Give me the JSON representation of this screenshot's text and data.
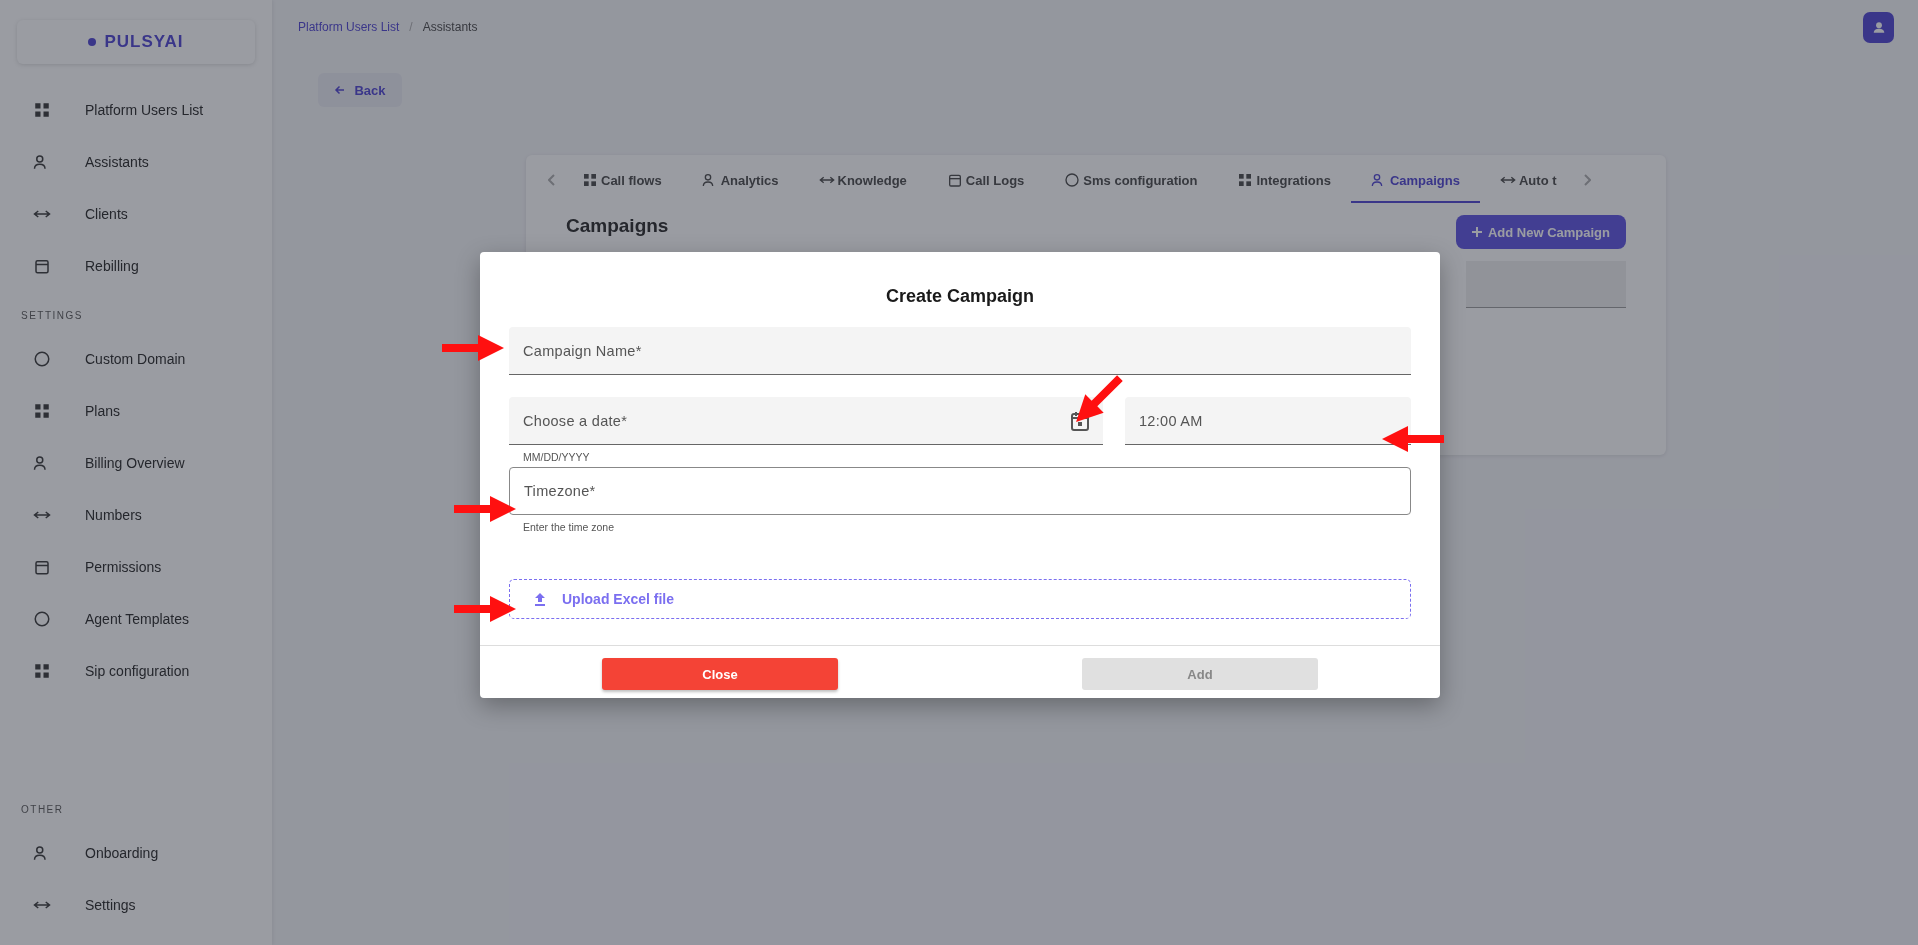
{
  "sidebar": {
    "logo": "PULSYAI",
    "sections": [
      {
        "items": [
          {
            "label": "Platform Users List"
          },
          {
            "label": "Assistants"
          },
          {
            "label": "Clients"
          },
          {
            "label": "Rebilling"
          }
        ]
      },
      {
        "heading": "SETTINGS",
        "items": [
          {
            "label": "Custom Domain"
          },
          {
            "label": "Plans"
          },
          {
            "label": "Billing Overview"
          },
          {
            "label": "Numbers"
          },
          {
            "label": "Permissions"
          },
          {
            "label": "Agent Templates"
          },
          {
            "label": "Sip configuration"
          }
        ]
      },
      {
        "heading": "OTHER",
        "items": [
          {
            "label": "Onboarding"
          },
          {
            "label": "Settings"
          }
        ]
      }
    ]
  },
  "breadcrumb": [
    {
      "label": "Platform Users List",
      "link": true
    },
    {
      "label": "Assistants",
      "link": false
    }
  ],
  "breadcrumb_separator": "/",
  "back_button": "Back",
  "tabs": [
    {
      "label": "Call flows",
      "selected": false
    },
    {
      "label": "Analytics",
      "selected": false
    },
    {
      "label": "Knowledge",
      "selected": false
    },
    {
      "label": "Call Logs",
      "selected": false
    },
    {
      "label": "Sms configuration",
      "selected": false
    },
    {
      "label": "Integrations",
      "selected": false
    },
    {
      "label": "Campaigns",
      "selected": true
    },
    {
      "label": "Auto t",
      "selected": false
    }
  ],
  "section_title": "Campaigns",
  "add_button": "Add New Campaign",
  "dialog": {
    "title": "Create Campaign",
    "fields": [
      {
        "kind": "filled",
        "label": "Campaign Name*"
      },
      {
        "kind": "date",
        "label": "Choose a date*",
        "helper": "MM/DD/YYYY"
      },
      {
        "kind": "time",
        "value": "12:00 AM"
      },
      {
        "kind": "outlined",
        "label": "Timezone*",
        "helper": "Enter the time zone"
      }
    ],
    "upload": "Upload Excel file",
    "buttons": [
      {
        "label": "Close",
        "disabled": false
      },
      {
        "label": "Add",
        "disabled": true
      }
    ]
  }
}
